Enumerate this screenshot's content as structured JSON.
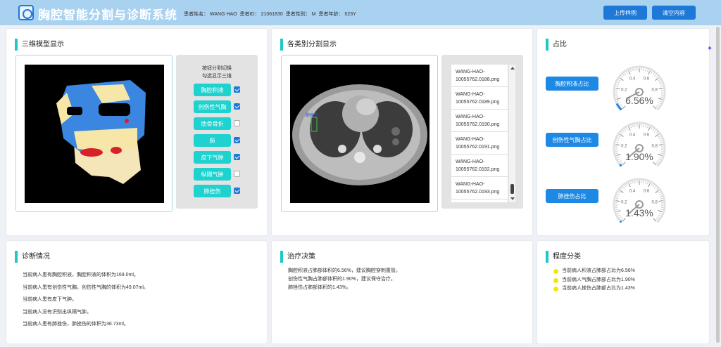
{
  "header": {
    "app_title": "胸腔智能分割与诊断系统",
    "patient_name_label": "患者姓名：",
    "patient_name": "WANG HAO",
    "patient_id_label": "患者ID：",
    "patient_id": "21061830",
    "patient_sex_label": "患者性别：",
    "patient_sex": "M",
    "patient_age_label": "患者年龄：",
    "patient_age": "023Y",
    "upload_label": "上传样例",
    "clear_label": "清空内容"
  },
  "model3d": {
    "title": "三维模型显示",
    "hint_line1": "按钮分割切换",
    "hint_line2": "勾选显示三维",
    "toggles": [
      {
        "label": "胸腔积液",
        "checked": true
      },
      {
        "label": "创伤性气胸",
        "checked": true
      },
      {
        "label": "肋骨骨折",
        "checked": false
      },
      {
        "label": "肺",
        "checked": true
      },
      {
        "label": "皮下气肿",
        "checked": true
      },
      {
        "label": "纵隔气肿",
        "checked": false
      },
      {
        "label": "肺挫伤",
        "checked": true
      }
    ]
  },
  "segmentation": {
    "title": "各类别分割显示",
    "ct_overlay_label": "肺挫伤",
    "files": [
      {
        "line1": "WANG-HAO-",
        "line2": "10055762.0188.png"
      },
      {
        "line1": "WANG-HAO-",
        "line2": "10055762.0189.png"
      },
      {
        "line1": "WANG-HAO-",
        "line2": "10055762.0190.png"
      },
      {
        "line1": "WANG-HAO-",
        "line2": "10055762.0191.png"
      },
      {
        "line1": "WANG-HAO-",
        "line2": "10055762.0192.png"
      },
      {
        "line1": "WANG-HAO-",
        "line2": "10055762.0193.png"
      }
    ]
  },
  "ratio": {
    "title": "占比",
    "gauge_ticks": [
      "0.2",
      "0.4",
      "0.6",
      "0.8"
    ],
    "items": [
      {
        "label": "胸腔积液占比",
        "value_text": "6.56%",
        "value": 0.0656
      },
      {
        "label": "创伤性气胸占比",
        "value_text": "1.90%",
        "value": 0.019
      },
      {
        "label": "肺挫伤占比",
        "value_text": "1.43%",
        "value": 0.0143
      }
    ]
  },
  "diagnosis": {
    "title": "诊断情况",
    "lines": [
      "当前病人患有胸腔积液，胸腔积液的体积为169.0ml。",
      "当前病人患有创伤性气胸，创伤性气胸的体积为49.07ml。",
      "当前病人患有皮下气肿。",
      "当前病人没有识别出纵隔气肿。",
      "当前病人患有肺挫伤，肺挫伤的体积为36.73ml。"
    ]
  },
  "treatment": {
    "title": "治疗决策",
    "lines": [
      "胸腔积液占肺部体积的6.56%，建议胸腔穿刺置管。",
      "创伤性气胸占肺部体积的1.90%，建议保守治疗。",
      "肺挫伤占肺部体积的1.43%。"
    ]
  },
  "grade": {
    "title": "程度分类",
    "dot_color": "#f5e60a",
    "lines": [
      "当前病人积液占肺部占比为6.56%",
      "当前病人气胸占肺部占比为1.90%",
      "当前病人挫伤占肺部占比为1.43%"
    ]
  },
  "colors": {
    "header_bg": "#a9d1f0",
    "accent_blue": "#1e78d8",
    "toggle_cyan": "#1ed2d0",
    "title_bar": "#1ec9c5"
  }
}
